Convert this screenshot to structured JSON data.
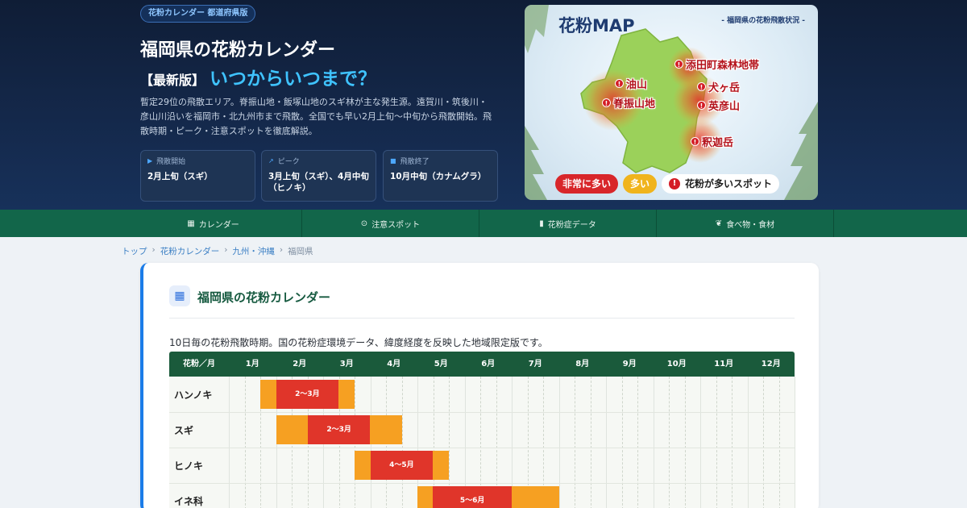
{
  "hero": {
    "badge": "花粉カレンダー 都道府県版",
    "title": "福岡県の花粉カレンダー",
    "subtitle_bracket": "【最新版】",
    "subtitle_main": "いつからいつまで？",
    "description": "暫定29位の飛散エリア。脊振山地・飯塚山地のスギ林が主な発生源。遠賀川・筑後川・彦山川沿いを福岡市・北九州市まで飛散。全国でも早い2月上旬〜中旬から飛散開始。飛散時期・ピーク・注意スポットを徹底解説。",
    "stats": [
      {
        "label": "飛散開始",
        "icon": "play-icon",
        "value": "2月上旬（スギ）"
      },
      {
        "label": "ピーク",
        "icon": "trend-icon",
        "value": "3月上旬（スギ）、4月中旬（ヒノキ）"
      },
      {
        "label": "飛散終了",
        "icon": "stop-icon",
        "value": "10月中旬（カナムグラ）"
      }
    ]
  },
  "map": {
    "title": "花粉MAP",
    "subtitle": "- 福岡県の花粉飛散状況 -",
    "markers": [
      "添田町森林地帯",
      "油山",
      "犬ヶ岳",
      "脊振山地",
      "英彦山",
      "釈迦岳"
    ],
    "legend": {
      "very_high": "非常に多い",
      "high": "多い",
      "spot": "花粉が多いスポット"
    },
    "colors": {
      "very_high": "#d8262a",
      "high": "#f0b41c",
      "land": "#9bd15a"
    }
  },
  "nav": [
    {
      "label": "カレンダー",
      "icon": "calendar-icon"
    },
    {
      "label": "注意スポット",
      "icon": "pin-icon"
    },
    {
      "label": "花粉症データ",
      "icon": "bar-chart-icon"
    },
    {
      "label": "食べ物・食材",
      "icon": "leaf-icon"
    }
  ],
  "breadcrumb": [
    "トップ",
    "花粉カレンダー",
    "九州・沖縄",
    "福岡県"
  ],
  "section": {
    "title": "福岡県の花粉カレンダー",
    "intro": "10日毎の花粉飛散時期。国の花粉症環境データ、緯度経度を反映した地域限定版です。"
  },
  "calendar": {
    "header_label": "花粉／月",
    "months": [
      "1月",
      "2月",
      "3月",
      "4月",
      "5月",
      "6月",
      "7月",
      "8月",
      "9月",
      "10月",
      "11月",
      "12月"
    ],
    "rows": [
      {
        "name": "ハンノキ",
        "start": 1.67,
        "end": 3.67,
        "peak_start": 2.0,
        "peak_end": 3.33,
        "peak_label": "2〜3月"
      },
      {
        "name": "スギ",
        "start": 2.0,
        "end": 4.67,
        "peak_start": 2.67,
        "peak_end": 4.0,
        "peak_label": "2〜3月"
      },
      {
        "name": "ヒノキ",
        "start": 3.67,
        "end": 5.67,
        "peak_start": 4.0,
        "peak_end": 5.33,
        "peak_label": "4〜5月"
      },
      {
        "name": "イネ科",
        "start": 5.0,
        "end": 8.0,
        "peak_start": 5.33,
        "peak_end": 7.0,
        "peak_label": "5〜6月"
      }
    ],
    "colors": {
      "season": "#f6a022",
      "peak": "#e0352a",
      "header": "#1a5a3b"
    }
  }
}
